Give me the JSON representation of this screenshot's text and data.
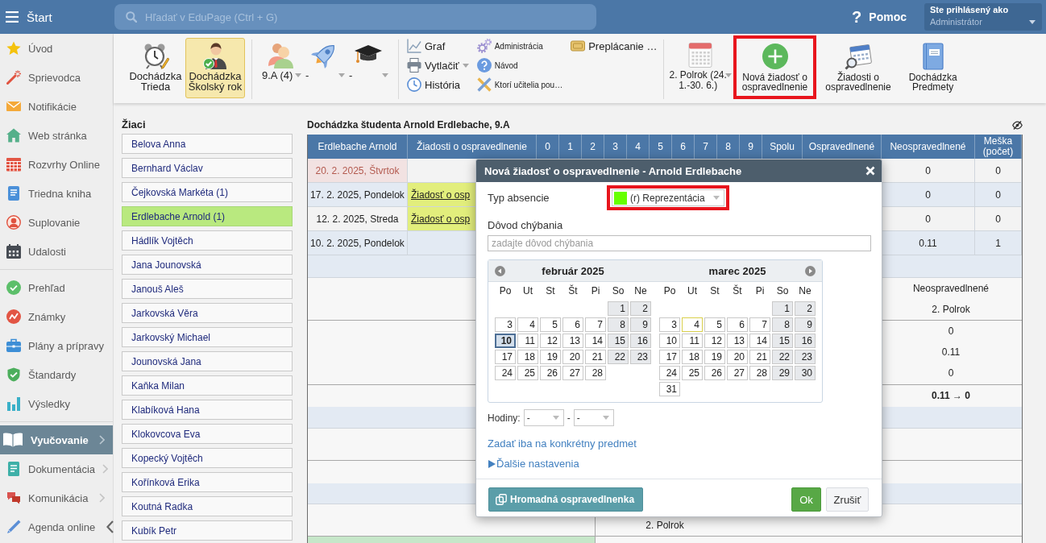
{
  "topbar": {
    "title": "Štart",
    "search": {
      "placeholder": "Hľadať v EduPage (Ctrl + G)"
    },
    "help": {
      "glyph": "?",
      "label": "Pomoc"
    },
    "account": {
      "caption": "Ste prihlásený ako",
      "user": "Administrátor"
    }
  },
  "sidebar": {
    "groups": [
      {
        "items": [
          {
            "label": "Úvod",
            "selected": false,
            "kind": "link"
          },
          {
            "label": "Sprievodca",
            "selected": false,
            "kind": "link"
          },
          {
            "label": "Notifikácie",
            "selected": false,
            "kind": "link"
          },
          {
            "label": "Web stránka",
            "selected": false,
            "kind": "link"
          },
          {
            "label": "Rozvrhy Online",
            "selected": false,
            "kind": "link"
          },
          {
            "label": "Triedna kniha",
            "selected": false,
            "kind": "link"
          },
          {
            "label": "Suplovanie",
            "selected": false,
            "kind": "link"
          },
          {
            "label": "Udalosti",
            "selected": false,
            "kind": "link"
          }
        ]
      },
      {
        "items": [
          {
            "label": "Prehľad",
            "selected": false,
            "kind": "link"
          },
          {
            "label": "Známky",
            "selected": false,
            "kind": "link"
          },
          {
            "label": "Plány a prípravy",
            "selected": false,
            "kind": "link"
          },
          {
            "label": "Štandardy",
            "selected": false,
            "kind": "link"
          },
          {
            "label": "Výsledky",
            "selected": false,
            "kind": "link"
          }
        ]
      },
      {
        "items": [
          {
            "label": "Vyučovanie",
            "selected": true,
            "kind": "submenu"
          },
          {
            "label": "Dokumentácia",
            "selected": false,
            "kind": "submenu"
          },
          {
            "label": "Komunikácia",
            "selected": false,
            "kind": "submenu"
          },
          {
            "label": "Agenda online",
            "selected": false,
            "kind": "collapsible"
          }
        ]
      }
    ]
  },
  "toolbar": {
    "views": [
      {
        "label": "Dochádzka\nTrieda",
        "selected": false
      },
      {
        "label": "Dochádzka\nŠkolský rok",
        "selected": true
      }
    ],
    "filters": [
      {
        "label": "9.A (4)"
      },
      {
        "label": "-"
      },
      {
        "label": "-"
      }
    ],
    "link_columns": [
      [
        {
          "label": "Graf",
          "dropdown": false
        },
        {
          "label": "Vytlačiť",
          "dropdown": true
        },
        {
          "label": "História",
          "dropdown": false
        }
      ],
      [
        {
          "label": "Administrácia",
          "dropdown": false
        },
        {
          "label": "Návod",
          "dropdown": false
        },
        {
          "label": "Ktorí učitelia pou…",
          "dropdown": false
        }
      ],
      [
        {
          "label": "Preplácanie …",
          "dropdown": false
        }
      ]
    ],
    "period": {
      "label": "2. Polrok (24.\n1.-30. 6.)"
    },
    "actions": [
      {
        "label": "Nová žiadosť o\nospravedlnenie",
        "highlighted": true
      },
      {
        "label": "Žiadosti o\nospravedlnenie",
        "highlighted": false
      },
      {
        "label": "Dochádzka\nPredmety",
        "highlighted": false
      }
    ]
  },
  "students": {
    "title": "Žiaci",
    "items": [
      {
        "name": "Belova Anna",
        "selected": false
      },
      {
        "name": "Bernhard Václav",
        "selected": false
      },
      {
        "name": "Čejkovská Markéta (1)",
        "selected": false
      },
      {
        "name": "Erdlebache Arnold (1)",
        "selected": true
      },
      {
        "name": "Hádlík Vojtěch",
        "selected": false
      },
      {
        "name": "Jana Jounovská",
        "selected": false
      },
      {
        "name": "Janouš Aleš",
        "selected": false
      },
      {
        "name": "Jarkovská Věra",
        "selected": false
      },
      {
        "name": "Jarkovský Michael",
        "selected": false
      },
      {
        "name": "Jounovská Jana",
        "selected": false
      },
      {
        "name": "Kaňka Milan",
        "selected": false
      },
      {
        "name": "Klabíková Hana",
        "selected": false
      },
      {
        "name": "Klokovcova Eva",
        "selected": false
      },
      {
        "name": "Kopecký Vojtěch",
        "selected": false
      },
      {
        "name": "Kořínková Erika",
        "selected": false
      },
      {
        "name": "Koutná Radka",
        "selected": false
      },
      {
        "name": "Kubík Petr",
        "selected": false
      }
    ]
  },
  "attendance": {
    "title": "Dochádzka študenta Arnold Erdlebache, 9.A",
    "columns": [
      "Erdlebache Arnold",
      "Žiadosti o ospravedlnenie",
      "0",
      "1",
      "2",
      "3",
      "4",
      "5",
      "6",
      "7",
      "8",
      "9",
      "Spolu",
      "Ospravedlnené",
      "Neospravedlnené",
      "Meška\n(počet)"
    ],
    "rows": [
      {
        "date": "20. 2. 2025, Štvrtok",
        "marked": true,
        "unexcused": "0",
        "late": "0"
      },
      {
        "date": "17. 2. 2025, Pondelok",
        "marked": false,
        "request": "Žiadosť o osp",
        "unexcused": "0",
        "late": "0"
      },
      {
        "date": "12. 2. 2025, Streda",
        "marked": false,
        "request": "Žiadosť o osp",
        "unexcused": "0",
        "late": "0"
      },
      {
        "date": "10. 2. 2025, Pondelok",
        "marked": false,
        "unexcused": "0.11",
        "late": "1"
      }
    ]
  },
  "summary": {
    "heading": "Neospravedlnené",
    "period": "2. Polrok",
    "values": [
      "0",
      "0.11",
      "0"
    ],
    "total": "0.11 → 0",
    "footer_period": "2. Polrok"
  },
  "dialog": {
    "title": "Nová žiadosť o ospravedlnenie - Arnold Erdlebache",
    "absence_type": {
      "label": "Typ absencie",
      "value": "(r) Reprezentácia",
      "color": "#66ff00",
      "highlighted": true
    },
    "reason": {
      "label": "Dôvod chýbania",
      "placeholder": "zadajte dôvod chýbania"
    },
    "calendar": {
      "months": [
        {
          "title": "február 2025",
          "weekdays": [
            "Po",
            "Ut",
            "St",
            "Št",
            "Pi",
            "So",
            "Ne"
          ],
          "weeks": [
            {
              "kind": "leading",
              "days": [
                {
                  "day": "1",
                  "selected": false,
                  "today": false
                },
                {
                  "day": "2",
                  "selected": false,
                  "today": false
                }
              ]
            },
            {
              "kind": "full",
              "days": [
                {
                  "day": "3",
                  "selected": false,
                  "today": false
                },
                {
                  "day": "4",
                  "selected": false,
                  "today": false
                },
                {
                  "day": "5",
                  "selected": false,
                  "today": false
                },
                {
                  "day": "6",
                  "selected": false,
                  "today": false
                },
                {
                  "day": "7",
                  "selected": false,
                  "today": false
                },
                {
                  "day": "8",
                  "selected": false,
                  "today": false
                },
                {
                  "day": "9",
                  "selected": false,
                  "today": false
                }
              ]
            },
            {
              "kind": "full",
              "days": [
                {
                  "day": "10",
                  "selected": true,
                  "today": false
                },
                {
                  "day": "11",
                  "selected": false,
                  "today": false
                },
                {
                  "day": "12",
                  "selected": false,
                  "today": false
                },
                {
                  "day": "13",
                  "selected": false,
                  "today": false
                },
                {
                  "day": "14",
                  "selected": false,
                  "today": false
                },
                {
                  "day": "15",
                  "selected": false,
                  "today": false
                },
                {
                  "day": "16",
                  "selected": false,
                  "today": false
                }
              ]
            },
            {
              "kind": "full",
              "days": [
                {
                  "day": "17",
                  "selected": false,
                  "today": false
                },
                {
                  "day": "18",
                  "selected": false,
                  "today": false
                },
                {
                  "day": "19",
                  "selected": false,
                  "today": false
                },
                {
                  "day": "20",
                  "selected": false,
                  "today": false
                },
                {
                  "day": "21",
                  "selected": false,
                  "today": false
                },
                {
                  "day": "22",
                  "selected": false,
                  "today": false
                },
                {
                  "day": "23",
                  "selected": false,
                  "today": false
                }
              ]
            },
            {
              "kind": "trailing",
              "days": [
                {
                  "day": "24",
                  "selected": false,
                  "today": false
                },
                {
                  "day": "25",
                  "selected": false,
                  "today": false
                },
                {
                  "day": "26",
                  "selected": false,
                  "today": false
                },
                {
                  "day": "27",
                  "selected": false,
                  "today": false
                },
                {
                  "day": "28",
                  "selected": false,
                  "today": false
                }
              ]
            }
          ]
        },
        {
          "title": "marec 2025",
          "weekdays": [
            "Po",
            "Ut",
            "St",
            "Št",
            "Pi",
            "So",
            "Ne"
          ],
          "weeks": [
            {
              "kind": "leading",
              "days": [
                {
                  "day": "1",
                  "selected": false,
                  "today": false
                },
                {
                  "day": "2",
                  "selected": false,
                  "today": false
                }
              ]
            },
            {
              "kind": "full",
              "days": [
                {
                  "day": "3",
                  "selected": false,
                  "today": false
                },
                {
                  "day": "4",
                  "selected": false,
                  "today": true
                },
                {
                  "day": "5",
                  "selected": false,
                  "today": false
                },
                {
                  "day": "6",
                  "selected": false,
                  "today": false
                },
                {
                  "day": "7",
                  "selected": false,
                  "today": false
                },
                {
                  "day": "8",
                  "selected": false,
                  "today": false
                },
                {
                  "day": "9",
                  "selected": false,
                  "today": false
                }
              ]
            },
            {
              "kind": "full",
              "days": [
                {
                  "day": "10",
                  "selected": false,
                  "today": false
                },
                {
                  "day": "11",
                  "selected": false,
                  "today": false
                },
                {
                  "day": "12",
                  "selected": false,
                  "today": false
                },
                {
                  "day": "13",
                  "selected": false,
                  "today": false
                },
                {
                  "day": "14",
                  "selected": false,
                  "today": false
                },
                {
                  "day": "15",
                  "selected": false,
                  "today": false
                },
                {
                  "day": "16",
                  "selected": false,
                  "today": false
                }
              ]
            },
            {
              "kind": "full",
              "days": [
                {
                  "day": "17",
                  "selected": false,
                  "today": false
                },
                {
                  "day": "18",
                  "selected": false,
                  "today": false
                },
                {
                  "day": "19",
                  "selected": false,
                  "today": false
                },
                {
                  "day": "20",
                  "selected": false,
                  "today": false
                },
                {
                  "day": "21",
                  "selected": false,
                  "today": false
                },
                {
                  "day": "22",
                  "selected": false,
                  "today": false
                },
                {
                  "day": "23",
                  "selected": false,
                  "today": false
                }
              ]
            },
            {
              "kind": "full",
              "days": [
                {
                  "day": "24",
                  "selected": false,
                  "today": false
                },
                {
                  "day": "25",
                  "selected": false,
                  "today": false
                },
                {
                  "day": "26",
                  "selected": false,
                  "today": false
                },
                {
                  "day": "27",
                  "selected": false,
                  "today": false
                },
                {
                  "day": "28",
                  "selected": false,
                  "today": false
                },
                {
                  "day": "29",
                  "selected": false,
                  "today": false
                },
                {
                  "day": "30",
                  "selected": false,
                  "today": false
                }
              ]
            },
            {
              "kind": "trailing",
              "days": [
                {
                  "day": "31",
                  "selected": false,
                  "today": false
                }
              ]
            }
          ]
        }
      ]
    },
    "hours": {
      "label": "Hodiny:",
      "from": "-",
      "separator": "-",
      "to": "-"
    },
    "subject_link": "Zadať iba na konkrétny predmet",
    "more_settings": {
      "label": "Ďalšie nastavenia",
      "expanded": false
    },
    "buttons": [
      {
        "label": "Hromadná ospravedlnenka",
        "kind": "bulk"
      },
      {
        "label": "Ok",
        "kind": "confirm"
      },
      {
        "label": "Zrušiť",
        "kind": "cancel"
      }
    ]
  }
}
